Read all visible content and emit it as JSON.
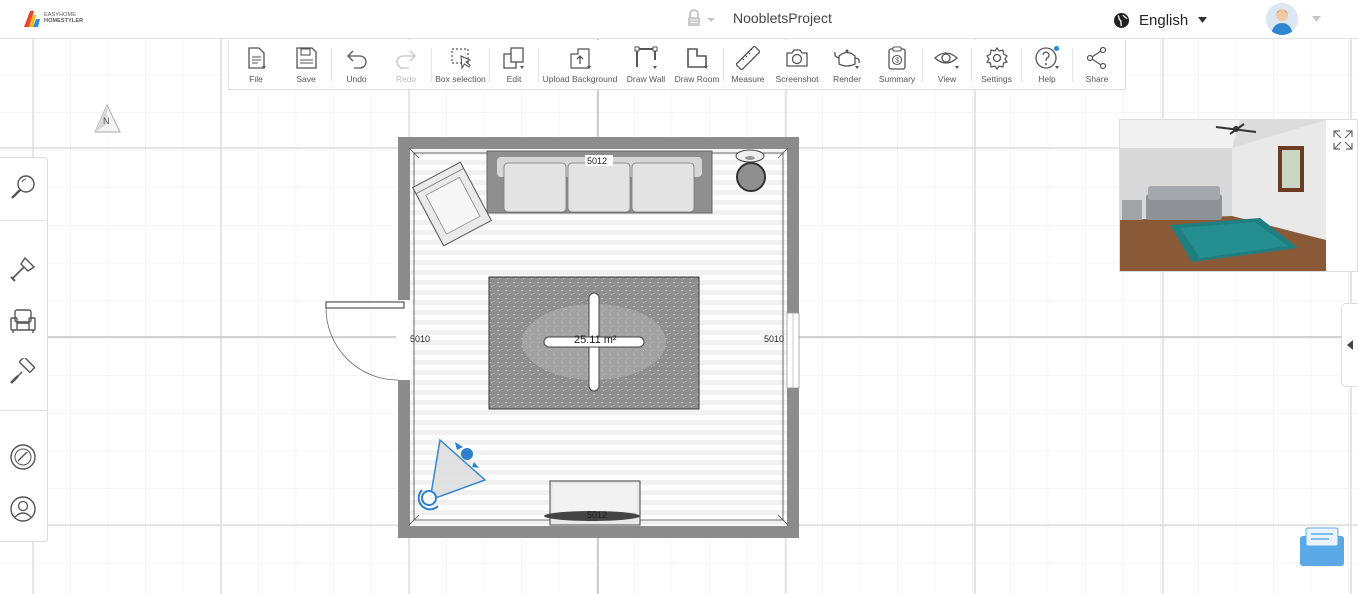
{
  "brand": {
    "line1": "EASYHOME",
    "line2": "HOMESTYLER"
  },
  "header": {
    "project_title": "NoobletsProject",
    "language": "English"
  },
  "toolbar": {
    "items": [
      {
        "label": "File",
        "icon": "file-icon"
      },
      {
        "label": "Save",
        "icon": "save-icon"
      },
      {
        "label": "Undo",
        "icon": "undo-icon"
      },
      {
        "label": "Redo",
        "icon": "redo-icon",
        "disabled": true
      },
      {
        "label": "Box selection",
        "icon": "box-selection-icon"
      },
      {
        "label": "Edit",
        "icon": "edit-icon"
      },
      {
        "label": "Upload Background",
        "icon": "upload-background-icon"
      },
      {
        "label": "Draw Wall",
        "icon": "draw-wall-icon"
      },
      {
        "label": "Draw Room",
        "icon": "draw-room-icon"
      },
      {
        "label": "Measure",
        "icon": "ruler-icon"
      },
      {
        "label": "Screenshot",
        "icon": "camera-icon"
      },
      {
        "label": "Render",
        "icon": "teapot-icon"
      },
      {
        "label": "Summary",
        "icon": "clipboard-dollar-icon"
      },
      {
        "label": "View",
        "icon": "eye-icon"
      },
      {
        "label": "Settings",
        "icon": "gear-icon"
      },
      {
        "label": "Help",
        "icon": "help-icon"
      },
      {
        "label": "Share",
        "icon": "share-icon"
      }
    ]
  },
  "left_panel": {
    "buttons": [
      "search-icon",
      "shovel-icon",
      "armchair-icon",
      "paint-roller-icon",
      "compass-icon",
      "user-icon"
    ]
  },
  "compass": {
    "label": "N"
  },
  "floorplan": {
    "dim_top": "5012",
    "dim_bottom": "5012",
    "dim_left": "5010",
    "dim_right": "5010",
    "area": "25.11 m²"
  },
  "colors": {
    "wall": "#8c8c8c",
    "grid_minor": "#e9e9e9",
    "grid_major": "#d7d7d7",
    "accent": "#2a8fd8",
    "camera": "#2e80cc"
  }
}
